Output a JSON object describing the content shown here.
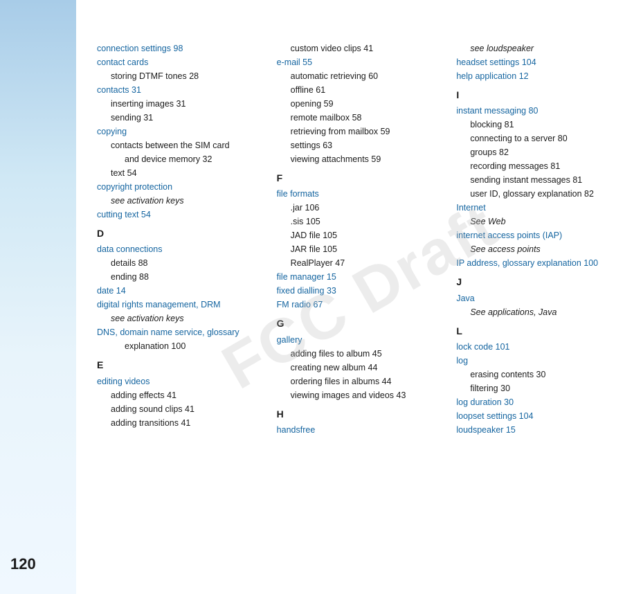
{
  "page": {
    "number": "120",
    "watermark": "FCC Draft"
  },
  "columns": [
    {
      "id": "col1",
      "entries": [
        {
          "type": "main-term",
          "text": "connection settings 98"
        },
        {
          "type": "main-term",
          "text": "contact cards"
        },
        {
          "type": "sub-term",
          "text": "storing DTMF tones  28"
        },
        {
          "type": "main-term",
          "text": "contacts  31"
        },
        {
          "type": "sub-term",
          "text": "inserting images  31"
        },
        {
          "type": "sub-term",
          "text": "sending  31"
        },
        {
          "type": "main-term",
          "text": "copying"
        },
        {
          "type": "sub-term",
          "text": "contacts between the SIM card"
        },
        {
          "type": "sub-sub-term",
          "text": "and device memory  32"
        },
        {
          "type": "sub-term",
          "text": "text  54"
        },
        {
          "type": "main-term",
          "text": "copyright protection"
        },
        {
          "type": "sub-term",
          "text": "see activation keys",
          "italic": true
        },
        {
          "type": "main-term",
          "text": "cutting text  54"
        },
        {
          "type": "section-letter",
          "text": "D"
        },
        {
          "type": "main-term",
          "text": "data connections"
        },
        {
          "type": "sub-term",
          "text": "details  88"
        },
        {
          "type": "sub-term",
          "text": "ending  88"
        },
        {
          "type": "main-term",
          "text": "date  14"
        },
        {
          "type": "main-term",
          "text": "digital rights management, DRM"
        },
        {
          "type": "sub-term",
          "text": "see activation keys",
          "italic": true
        },
        {
          "type": "main-term",
          "text": "DNS, domain name service, glossary"
        },
        {
          "type": "sub-sub-term",
          "text": "explanation  100"
        },
        {
          "type": "section-letter",
          "text": "E"
        },
        {
          "type": "main-term",
          "text": "editing videos"
        },
        {
          "type": "sub-term",
          "text": "adding effects  41"
        },
        {
          "type": "sub-term",
          "text": "adding sound clips  41"
        },
        {
          "type": "sub-term",
          "text": "adding transitions  41"
        }
      ]
    },
    {
      "id": "col2",
      "entries": [
        {
          "type": "sub-term",
          "text": "custom video clips  41"
        },
        {
          "type": "main-term",
          "text": "e-mail  55"
        },
        {
          "type": "sub-term",
          "text": "automatic retrieving  60"
        },
        {
          "type": "sub-term",
          "text": "offline  61"
        },
        {
          "type": "sub-term",
          "text": "opening  59"
        },
        {
          "type": "sub-term",
          "text": "remote mailbox  58"
        },
        {
          "type": "sub-term",
          "text": "retrieving from mailbox  59"
        },
        {
          "type": "sub-term",
          "text": "settings  63"
        },
        {
          "type": "sub-term",
          "text": "viewing attachments  59"
        },
        {
          "type": "section-letter",
          "text": "F"
        },
        {
          "type": "main-term",
          "text": "file formats"
        },
        {
          "type": "sub-term",
          "text": ".jar  106"
        },
        {
          "type": "sub-term",
          "text": ".sis  105"
        },
        {
          "type": "sub-term",
          "text": "JAD file  105"
        },
        {
          "type": "sub-term",
          "text": "JAR file  105"
        },
        {
          "type": "sub-term",
          "text": "RealPlayer  47"
        },
        {
          "type": "main-term",
          "text": "file manager  15"
        },
        {
          "type": "main-term",
          "text": "fixed dialling  33"
        },
        {
          "type": "main-term",
          "text": "FM radio  67"
        },
        {
          "type": "section-letter",
          "text": "G"
        },
        {
          "type": "main-term",
          "text": "gallery"
        },
        {
          "type": "sub-term",
          "text": "adding files to album  45"
        },
        {
          "type": "sub-term",
          "text": "creating new album  44"
        },
        {
          "type": "sub-term",
          "text": "ordering files in albums  44"
        },
        {
          "type": "sub-term",
          "text": "viewing images and videos  43"
        },
        {
          "type": "section-letter",
          "text": "H"
        },
        {
          "type": "main-term",
          "text": "handsfree"
        }
      ]
    },
    {
      "id": "col3",
      "entries": [
        {
          "type": "sub-term",
          "text": "see loudspeaker",
          "italic": true
        },
        {
          "type": "main-term",
          "text": "headset settings  104"
        },
        {
          "type": "main-term",
          "text": "help application  12"
        },
        {
          "type": "section-letter",
          "text": "I"
        },
        {
          "type": "main-term",
          "text": "instant messaging  80"
        },
        {
          "type": "sub-term",
          "text": "blocking  81"
        },
        {
          "type": "sub-term",
          "text": "connecting to a server  80"
        },
        {
          "type": "sub-term",
          "text": "groups  82"
        },
        {
          "type": "sub-term",
          "text": "recording messages  81"
        },
        {
          "type": "sub-term",
          "text": "sending instant messages  81"
        },
        {
          "type": "sub-term",
          "text": "user ID, glossary explanation  82"
        },
        {
          "type": "main-term",
          "text": "Internet"
        },
        {
          "type": "sub-term",
          "text": "See Web",
          "italic": true
        },
        {
          "type": "main-term",
          "text": "internet access points (IAP)"
        },
        {
          "type": "sub-term",
          "text": "See access points",
          "italic": true
        },
        {
          "type": "main-term",
          "text": "IP address, glossary explanation  100"
        },
        {
          "type": "section-letter",
          "text": "J"
        },
        {
          "type": "main-term",
          "text": "Java"
        },
        {
          "type": "sub-term",
          "text": "See applications, Java",
          "italic": true
        },
        {
          "type": "section-letter",
          "text": "L"
        },
        {
          "type": "main-term",
          "text": "lock code  101"
        },
        {
          "type": "main-term",
          "text": "log"
        },
        {
          "type": "sub-term",
          "text": "erasing contents  30"
        },
        {
          "type": "sub-term",
          "text": "filtering  30"
        },
        {
          "type": "main-term",
          "text": "log duration  30"
        },
        {
          "type": "main-term",
          "text": "loopset settings  104"
        },
        {
          "type": "main-term",
          "text": "loudspeaker  15"
        }
      ]
    }
  ]
}
